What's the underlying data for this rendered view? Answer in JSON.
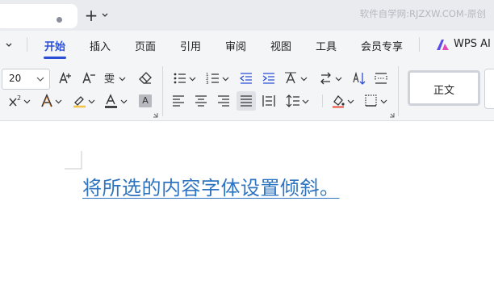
{
  "titlebar": {
    "tab_dot": "unsaved-dot",
    "new_tab_label": "+",
    "watermark": "软件自学网:RJZXW.COM-原创"
  },
  "menu": {
    "items": [
      "开始",
      "插入",
      "页面",
      "引用",
      "审阅",
      "视图",
      "工具",
      "会员专享"
    ],
    "active": "开始",
    "wps_ai": "WPS AI"
  },
  "ribbon": {
    "font_size": "20",
    "style_name": "正文",
    "shading_label": "A"
  },
  "document": {
    "text": "将所选的内容字体设置倾斜。"
  },
  "colors": {
    "accent": "#2a4fd6",
    "doc_text": "#2f74c0",
    "font_color_bar": "#222222",
    "highlight_bar": "#f5c242"
  }
}
